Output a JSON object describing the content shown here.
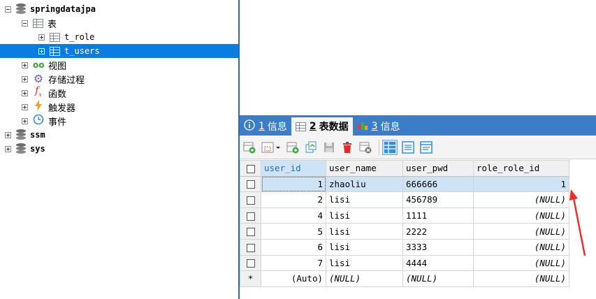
{
  "tree": {
    "items": [
      {
        "label": "springdatajpa",
        "icon": "database-icon",
        "expanded": true
      },
      {
        "label": "表",
        "icon": "table-folder-icon",
        "expanded": true
      },
      {
        "label": "t_role",
        "icon": "table-icon",
        "expanded": false
      },
      {
        "label": "t_users",
        "icon": "table-icon",
        "expanded": false,
        "selected": true
      },
      {
        "label": "视图",
        "icon": "view-icon",
        "expanded": false
      },
      {
        "label": "存储过程",
        "icon": "gear-icon",
        "expanded": false
      },
      {
        "label": "函数",
        "icon": "function-icon",
        "expanded": false
      },
      {
        "label": "触发器",
        "icon": "lightning-icon",
        "expanded": false
      },
      {
        "label": "事件",
        "icon": "clock-icon",
        "expanded": false
      },
      {
        "label": "ssm",
        "icon": "database-icon",
        "expanded": false
      },
      {
        "label": "sys",
        "icon": "database-icon",
        "expanded": false
      }
    ]
  },
  "tabs": [
    {
      "num": "1",
      "label": "信息",
      "icon": "info-icon"
    },
    {
      "num": "2",
      "label": "表数据",
      "icon": "table-icon",
      "active": true
    },
    {
      "num": "3",
      "label": "信息",
      "icon": "chart-icon"
    }
  ],
  "grid": {
    "columns": [
      "user_id",
      "user_name",
      "user_pwd",
      "role_role_id"
    ],
    "rows": [
      {
        "user_id": "1",
        "user_name": "zhaoliu",
        "user_pwd": "666666",
        "role_role_id": "1"
      },
      {
        "user_id": "2",
        "user_name": "lisi",
        "user_pwd": "456789",
        "role_role_id": "(NULL)"
      },
      {
        "user_id": "4",
        "user_name": "lisi",
        "user_pwd": "1111",
        "role_role_id": "(NULL)"
      },
      {
        "user_id": "5",
        "user_name": "lisi",
        "user_pwd": "2222",
        "role_role_id": "(NULL)"
      },
      {
        "user_id": "6",
        "user_name": "lisi",
        "user_pwd": "3333",
        "role_role_id": "(NULL)"
      },
      {
        "user_id": "7",
        "user_name": "lisi",
        "user_pwd": "4444",
        "role_role_id": "(NULL)"
      }
    ],
    "new_row": {
      "marker": "*",
      "user_id": "(Auto)",
      "user_name": "(NULL)",
      "user_pwd": "(NULL)",
      "role_role_id": "(NULL)"
    }
  },
  "colors": {
    "selection": "#0a7ee0",
    "tabbar": "#3b7ec7",
    "arrow": "#e8322d"
  }
}
